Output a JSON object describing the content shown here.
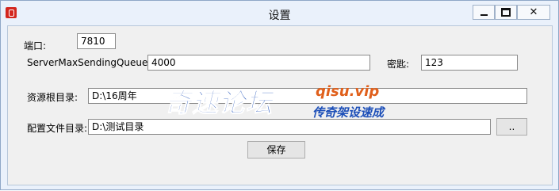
{
  "window": {
    "title": "设置"
  },
  "titlebar_buttons": {
    "close_glyph": "✕"
  },
  "form": {
    "port_label": "端口:",
    "port_value": "7810",
    "queue_label": "ServerMaxSendingQueueSize",
    "queue_value": "4000",
    "key_label": "密匙:",
    "key_value": "123",
    "resource_label": "资源根目录:",
    "resource_value": "D:\\16周年",
    "config_label": "配置文件目录:",
    "config_value": "D:\\测试目录",
    "browse_label": "..",
    "save_label": "保存"
  },
  "watermark": {
    "brand": "奇速论坛",
    "url": "qisu.vip",
    "tagline": "传奇架设速成"
  },
  "colors": {
    "accent": "#1d4fb8",
    "url_orange": "#e0601c"
  }
}
